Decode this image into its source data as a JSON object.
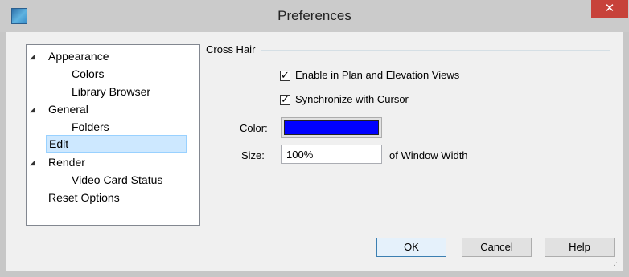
{
  "window": {
    "title": "Preferences",
    "close_glyph": "✕",
    "app_icon": "app-icon"
  },
  "tree": {
    "items": [
      {
        "label": "Appearance",
        "level": 0,
        "expanded": true
      },
      {
        "label": "Colors",
        "level": 1
      },
      {
        "label": "Library Browser",
        "level": 1
      },
      {
        "label": "General",
        "level": 0,
        "expanded": true
      },
      {
        "label": "Folders",
        "level": 1
      },
      {
        "label": "Edit",
        "level": 0,
        "selected": true
      },
      {
        "label": "Render",
        "level": 0,
        "expanded": true
      },
      {
        "label": "Video Card Status",
        "level": 1
      },
      {
        "label": "Reset Options",
        "level": 0
      }
    ],
    "expand_glyph": "◢"
  },
  "cross_hair": {
    "group_label": "Cross Hair",
    "enable_label": "Enable in Plan and Elevation Views",
    "enable_checked": true,
    "sync_label": "Synchronize with Cursor",
    "sync_checked": true,
    "check_glyph": "✓",
    "color_label": "Color:",
    "color_value": "#0000ff",
    "size_label": "Size:",
    "size_value": "100%",
    "size_suffix": "of Window Width"
  },
  "buttons": {
    "ok": "OK",
    "cancel": "Cancel",
    "help": "Help"
  },
  "colors": {
    "selection_bg": "#cde8ff",
    "close_button": "#c7423a",
    "swatch": "#0000ff"
  }
}
